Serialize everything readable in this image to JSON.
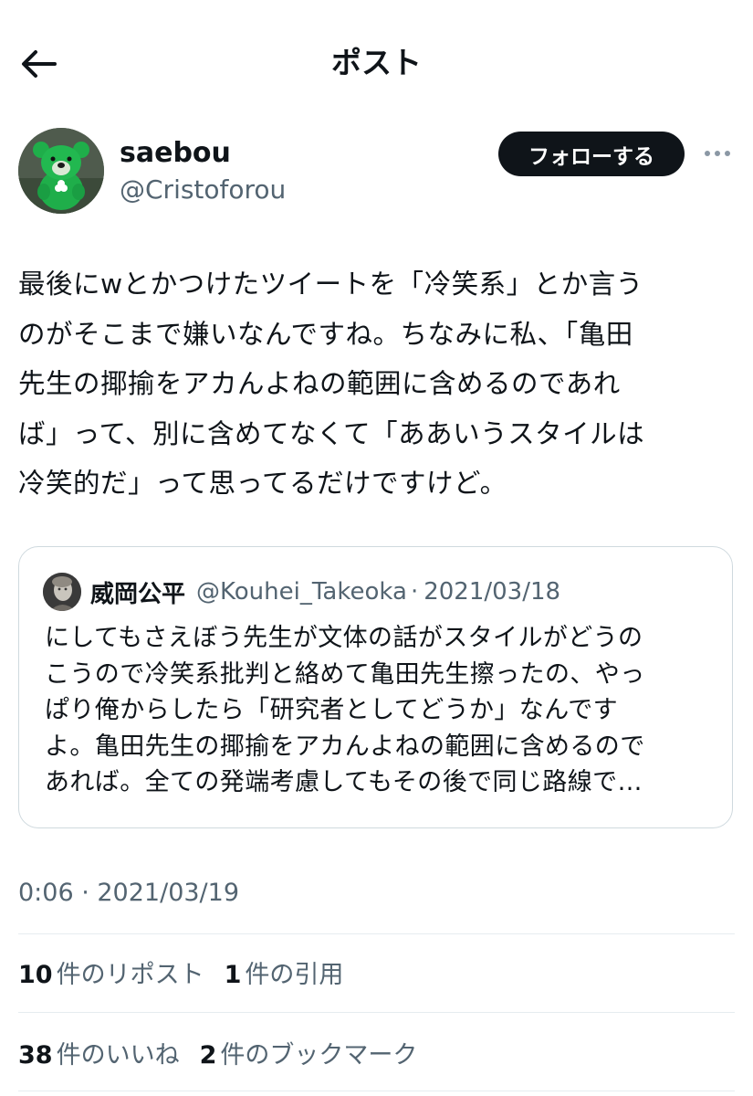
{
  "header": {
    "title": "ポスト",
    "back_icon": "arrow-left-icon"
  },
  "author": {
    "display_name": "saebou",
    "handle": "@Cristoforou",
    "follow_label": "フォローする",
    "more_icon": "more-horizontal-icon"
  },
  "tweet": {
    "text": "最後にwとかつけたツイートを「冷笑系」とか言う\nのがそこまで嫌いなんですね。ちなみに私、「亀田\n先生の揶揄をアカんよねの範囲に含めるのであれ\nば」って、別に含めてなくて「ああいうスタイルは\n冷笑的だ」って思ってるだけですけど。",
    "timestamp": "0:06 · 2021/03/19"
  },
  "quote": {
    "name": "威岡公平",
    "handle": "@Kouhei_Takeoka",
    "dot": "·",
    "date": "2021/03/18",
    "text": "にしてもさえぼう先生が文体の話がスタイルがどうの\nこうので冷笑系批判と絡めて亀田先生擦ったの、やっ\nぱり俺からしたら「研究者としてどうか」なんです\nよ。亀田先生の揶揄をアカんよねの範囲に含めるので\nあれば。全ての発端考慮してもその後で同じ路線で…"
  },
  "stats": {
    "reposts_count": "10",
    "reposts_label": "件のリポスト",
    "quotes_count": "1",
    "quotes_label": "件の引用",
    "likes_count": "38",
    "likes_label": "件のいいね",
    "bookmarks_count": "2",
    "bookmarks_label": "件のブックマーク"
  },
  "colors": {
    "text_primary": "#0f1419",
    "text_secondary": "#536471",
    "border": "#cfd9de",
    "follow_bg": "#0f1419"
  }
}
